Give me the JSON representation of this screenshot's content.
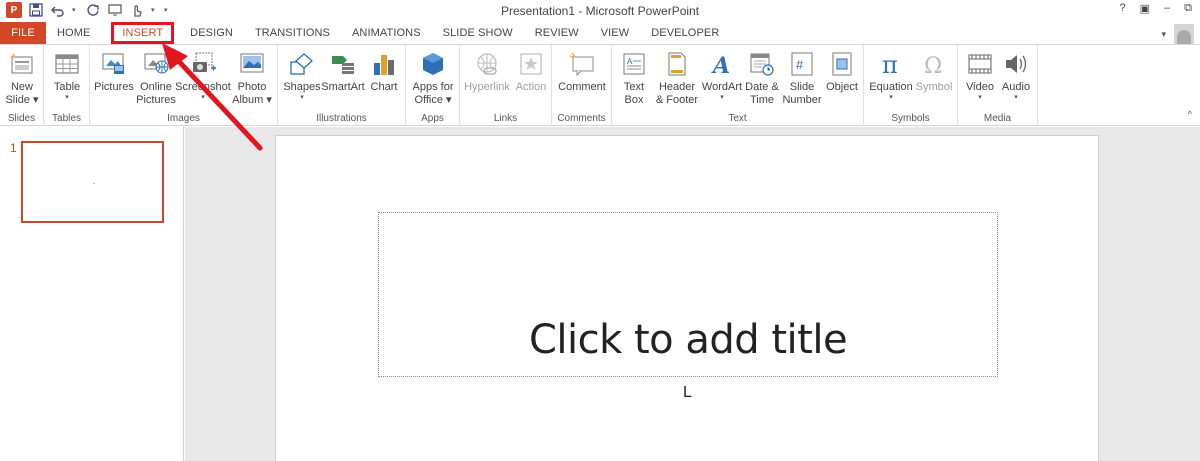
{
  "window": {
    "title": "Presentation1 - Microsoft PowerPoint",
    "controls": [
      "?",
      "▣",
      "–",
      "⧉"
    ]
  },
  "qat": {
    "logo": "P",
    "customize_arrow": "▾"
  },
  "tabs": [
    {
      "label": "FILE"
    },
    {
      "label": "HOME"
    },
    {
      "label": "INSERT"
    },
    {
      "label": "DESIGN"
    },
    {
      "label": "TRANSITIONS"
    },
    {
      "label": "ANIMATIONS"
    },
    {
      "label": "SLIDE SHOW"
    },
    {
      "label": "REVIEW"
    },
    {
      "label": "VIEW"
    },
    {
      "label": "DEVELOPER"
    }
  ],
  "ribbon": {
    "groups": {
      "slides": "Slides",
      "tables": "Tables",
      "images": "Images",
      "illustrations": "Illustrations",
      "apps": "Apps",
      "links": "Links",
      "comments": "Comments",
      "text": "Text",
      "symbols": "Symbols",
      "media": "Media"
    },
    "buttons": {
      "new_slide": [
        "New",
        "Slide ▾"
      ],
      "table": [
        "Table",
        "▾"
      ],
      "pictures": [
        "Pictures"
      ],
      "online_pictures": [
        "Online",
        "Pictures"
      ],
      "screenshot": [
        "Screenshot",
        "▾"
      ],
      "photo_album": [
        "Photo",
        "Album ▾"
      ],
      "shapes": [
        "Shapes",
        "▾"
      ],
      "smartart": [
        "SmartArt"
      ],
      "chart": [
        "Chart"
      ],
      "apps_for_office": [
        "Apps for",
        "Office ▾"
      ],
      "hyperlink": [
        "Hyperlink"
      ],
      "action": [
        "Action"
      ],
      "comment": [
        "Comment"
      ],
      "text_box": [
        "Text",
        "Box"
      ],
      "header_footer": [
        "Header",
        "& Footer"
      ],
      "wordart": [
        "WordArt",
        "▾"
      ],
      "date_time": [
        "Date &",
        "Time"
      ],
      "slide_number": [
        "Slide",
        "Number"
      ],
      "object": [
        "Object"
      ],
      "equation": [
        "Equation",
        "▾"
      ],
      "symbol": [
        "Symbol"
      ],
      "video": [
        "Video",
        "▾"
      ],
      "audio": [
        "Audio",
        "▾"
      ]
    },
    "collapse": "^"
  },
  "thumbs": {
    "slide_number": "1"
  },
  "slide": {
    "title_placeholder": "Click to add title",
    "cursor_char": "L"
  },
  "colors": {
    "accent": "#d24726",
    "highlight": "#e3141e"
  }
}
